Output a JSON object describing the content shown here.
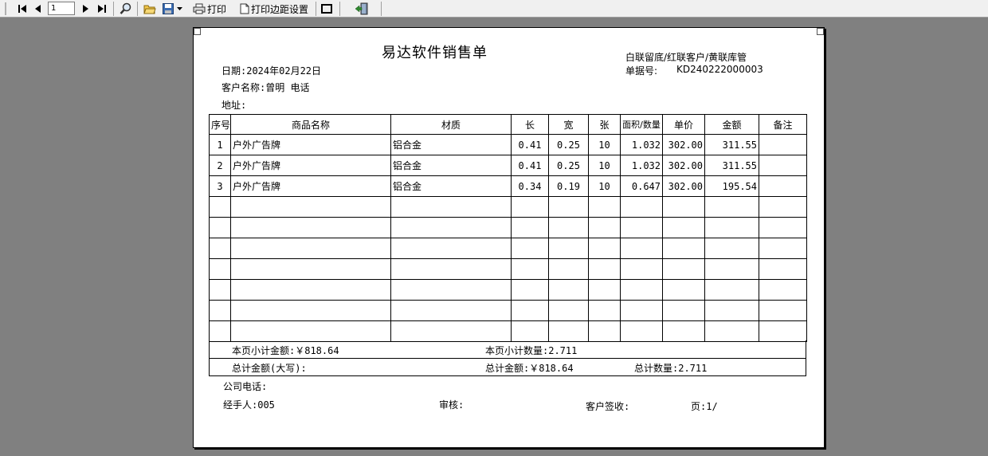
{
  "toolbar": {
    "page_value": "1",
    "print_label": "打印",
    "margin_label": "打印边距设置"
  },
  "doc": {
    "title": "易达软件销售单",
    "copy_note": "白联留底/红联客户/黄联库管",
    "order_no_label": "单据号:",
    "order_no": "KD240222000003",
    "date": "日期:2024年02月22日",
    "customer": "客户名称:曾明 电话",
    "address": "地址:",
    "headers": [
      "序号",
      "商品名称",
      "材质",
      "长",
      "宽",
      "张",
      "面积/数量",
      "单价",
      "金额",
      "备注"
    ],
    "rows": [
      [
        "1",
        "户外广告牌",
        "铝合金",
        "0.41",
        "0.25",
        "10",
        "1.032",
        "302.00",
        "311.55",
        ""
      ],
      [
        "2",
        "户外广告牌",
        "铝合金",
        "0.41",
        "0.25",
        "10",
        "1.032",
        "302.00",
        "311.55",
        ""
      ],
      [
        "3",
        "户外广告牌",
        "铝合金",
        "0.34",
        "0.19",
        "10",
        "0.647",
        "302.00",
        "195.54",
        ""
      ]
    ],
    "page_subtotal_amount": "本页小计金额:￥818.64",
    "page_subtotal_qty": "本页小计数量:2.711",
    "total_amount_upper": "总计金额(大写):",
    "total_amount": "总计金额:￥818.64",
    "total_qty": "总计数量:2.711",
    "company_phone": "公司电话:",
    "handler": "经手人:005",
    "reviewer": "审核:",
    "customer_sign": "客户签收:",
    "page_info": "页:1/"
  }
}
